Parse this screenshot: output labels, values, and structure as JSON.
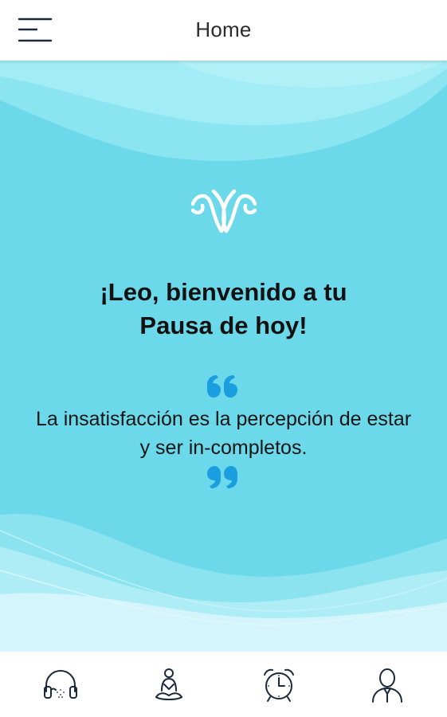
{
  "header": {
    "title": "Home",
    "menu_icon": "hamburger-menu-icon"
  },
  "hero": {
    "logo_icon": "butterfly-logo-icon",
    "welcome_line1": "¡Leo, bienvenido a tu",
    "welcome_line2": "Pausa de hoy!",
    "quote_line1": "La insatisfacción es la percepción de estar",
    "quote_line2": "y ser in-completos.",
    "quote_color": "#1a9ee0",
    "background_color": "#6cd9ea"
  },
  "tabbar": {
    "tabs": [
      {
        "icon": "headphones-icon"
      },
      {
        "icon": "meditation-icon"
      },
      {
        "icon": "alarm-clock-icon"
      },
      {
        "icon": "user-profile-icon"
      }
    ]
  }
}
